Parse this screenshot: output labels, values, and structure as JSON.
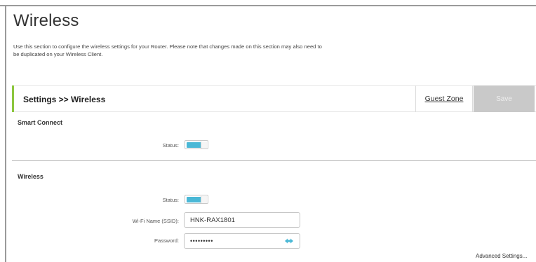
{
  "page": {
    "title": "Wireless",
    "description": "Use this section to configure the wireless settings for your Router. Please note that changes made on this section may also need to be duplicated on your Wireless Client."
  },
  "header_bar": {
    "breadcrumb": "Settings >> Wireless",
    "guest_zone_label": "Guest Zone",
    "save_label": "Save"
  },
  "smart_connect": {
    "title": "Smart Connect",
    "status_label": "Status:",
    "status_on": true
  },
  "wireless": {
    "title": "Wireless",
    "status_label": "Status:",
    "status_on": true,
    "ssid_label": "Wi-Fi Name (SSID):",
    "ssid_value": "HNK-RAX1801",
    "password_label": "Password:",
    "password_masked": "•••••••••"
  },
  "advanced_settings_label": "Advanced Settings...",
  "colors": {
    "accent_green": "#8cc63e",
    "toggle_blue": "#4ab8d6",
    "save_disabled_bg": "#c9c9c9"
  },
  "icons": {
    "password_toggle": "eye-icon"
  }
}
